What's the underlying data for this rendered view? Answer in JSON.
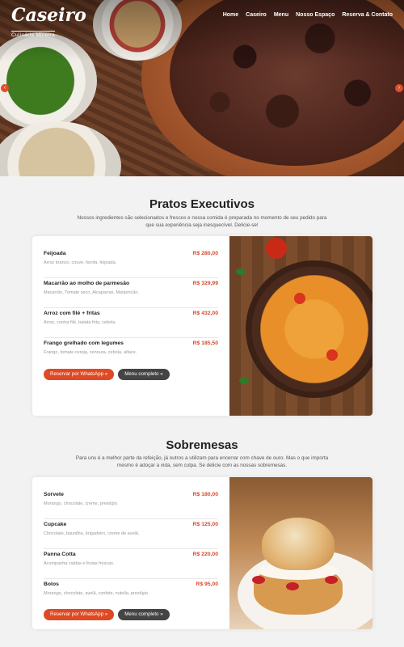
{
  "brand": {
    "name": "Caseiro",
    "tagline": "Culinária Mineira"
  },
  "nav": [
    "Home",
    "Caseiro",
    "Menu",
    "Nosso Espaço",
    "Reserva & Contato"
  ],
  "slider": {
    "prev_icon": "‹",
    "next_icon": "›"
  },
  "colors": {
    "accent": "#de4a23",
    "price": "#d9472b",
    "dark_button": "#444444"
  },
  "pratos": {
    "title": "Pratos Executivos",
    "description": "Nossos ingredientes são selecionados e frescos e nossa comida é preparada no momento de seu pedido para que sua experiência seja inesquecível. Delicie-se!",
    "items": [
      {
        "name": "Feijoada",
        "price": "R$ 280,00",
        "ingredients": "Arroz branco, couve, farofa, feijoada."
      },
      {
        "name": "Macarrão ao molho de parmesão",
        "price": "R$ 329,99",
        "ingredients": "Macarrão, Tomate seco, Alcaparras, Manjericão."
      },
      {
        "name": "Arroz com filé + fritas",
        "price": "R$ 432,00",
        "ingredients": "Arroz, contra filé, batata frita, cebola."
      },
      {
        "name": "Frango grelhado com legumes",
        "price": "R$ 185,50",
        "ingredients": "Frango, tomate cereja, cenoura, cebola, alface."
      }
    ],
    "btn_whatsapp": "Reservar por WhatsApp »",
    "btn_menu": "Menu completo »"
  },
  "sobremesas": {
    "title": "Sobremesas",
    "description": "Para uns é a melhor parte da refeição, já outros a utilizam para encerrar com chave de ouro. Mas o que importa mesmo é adoçar a vida, sem culpa. Se delicie com as nossas sobremesas.",
    "items": [
      {
        "name": "Sorvete",
        "price": "R$ 180,00",
        "ingredients": "Morango, chocolate, creme, prestígio."
      },
      {
        "name": "Cupcake",
        "price": "R$ 125,00",
        "ingredients": "Chocolate, baunilha, brigadeiro, creme de avelã."
      },
      {
        "name": "Panna Cotta",
        "price": "R$ 220,00",
        "ingredients": "Acompanha caldas e frutas frescas."
      },
      {
        "name": "Bolos",
        "price": "R$ 95,00",
        "ingredients": "Morango, chocolate, avelã, confete, nutella, prestígio."
      }
    ],
    "btn_whatsapp": "Reservar por WhatsApp »",
    "btn_menu": "Menu completo »"
  }
}
